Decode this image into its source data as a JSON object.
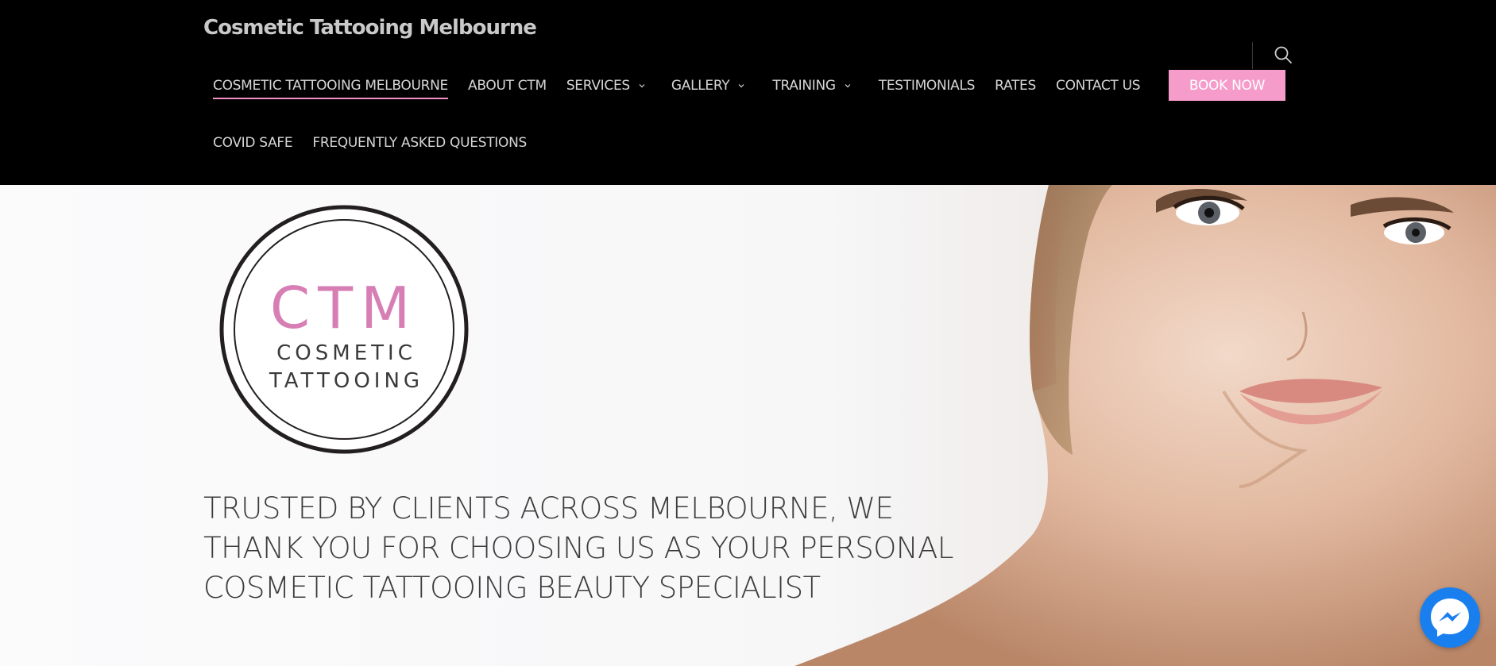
{
  "header": {
    "site_title": "Cosmetic Tattooing Melbourne",
    "nav_row1": [
      {
        "label": "COSMETIC TATTOOING MELBOURNE",
        "has_dropdown": false,
        "active": true
      },
      {
        "label": "ABOUT CTM",
        "has_dropdown": false
      },
      {
        "label": "SERVICES",
        "has_dropdown": true
      },
      {
        "label": "GALLERY",
        "has_dropdown": true
      },
      {
        "label": "TRAINING",
        "has_dropdown": true
      },
      {
        "label": "TESTIMONIALS",
        "has_dropdown": false
      },
      {
        "label": "RATES",
        "has_dropdown": false
      },
      {
        "label": "CONTACT US",
        "has_dropdown": false
      }
    ],
    "nav_row2": [
      {
        "label": "COVID SAFE"
      },
      {
        "label": "FREQUENTLY ASKED QUESTIONS"
      }
    ],
    "book_now_label": "BOOK NOW",
    "search_icon": "search-icon"
  },
  "hero": {
    "logo": {
      "line1": "CTM",
      "line2": "COSMETIC",
      "line3": "TATTOOING"
    },
    "tagline": [
      "TRUSTED BY CLIENTS ACROSS MELBOURNE, WE",
      "THANK YOU FOR CHOOSING US AS YOUR PERSONAL",
      "COSMETIC TATTOOING BEAUTY SPECIALIST"
    ]
  },
  "chat_widget": {
    "icon": "messenger-icon"
  },
  "colors": {
    "header_bg": "#000000",
    "accent_pink": "#f59ccb",
    "logo_pink": "#d77fb5",
    "messenger_blue": "#1a7fee"
  }
}
